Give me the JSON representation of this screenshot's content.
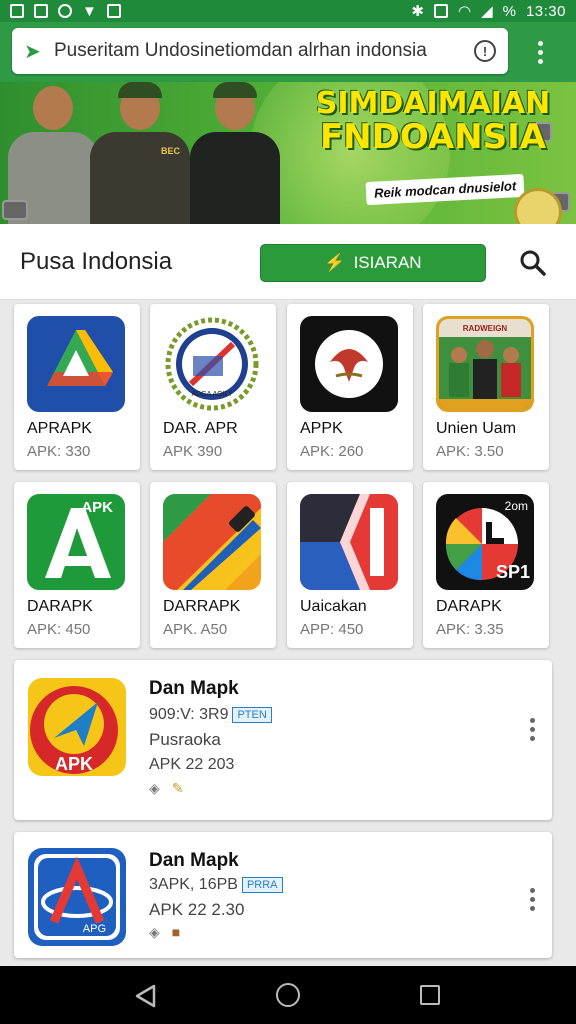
{
  "status_bar": {
    "time": "13:30",
    "battery": "%"
  },
  "browser": {
    "url": "Puseritam Undosinetiomdan alrhan indonsia",
    "info_glyph": "!"
  },
  "banner": {
    "title_line1": "SIMDAIMAIAN",
    "title_line2": "FNDOANSIA",
    "tagline": "Reik modcan dnusielot",
    "badge_text": "BEC"
  },
  "header": {
    "title": "Pusa Indonsia",
    "button_label": "ISIARAN"
  },
  "grid": [
    {
      "name": "APRAPK",
      "meta": "APK: 330",
      "icon": "drive-triangle-icon"
    },
    {
      "name": "DAR. APR",
      "meta": "APK 390",
      "icon": "emblem-pen-icon",
      "icon_text": "ADGA AGILY"
    },
    {
      "name": "APPK",
      "meta": "APK: 260",
      "icon": "garuda-icon"
    },
    {
      "name": "Unien Uam",
      "meta": "APK: 3.50",
      "icon": "team-photo-icon",
      "icon_text": "RADWEIGN"
    },
    {
      "name": "DARAPK",
      "meta": "APK: 450",
      "icon": "green-a-icon",
      "icon_text": "APK"
    },
    {
      "name": "DARRAPK",
      "meta": "APK. A50",
      "icon": "colorful-stripes-icon"
    },
    {
      "name": "Uaicakan",
      "meta": "APP: 450",
      "icon": "red-blue-k-icon"
    },
    {
      "name": "DARAPK",
      "meta": "APK: 3.35",
      "icon": "pie-sp-icon",
      "icon_text": "2om",
      "icon_text2": "SP1"
    }
  ],
  "list": [
    {
      "name": "Dan Mapk",
      "line1": "909:V: 3R9",
      "badge": "PTEN",
      "line2": "Pusraoka",
      "line3": "APK 22 203",
      "icon": "apk-arrow-icon",
      "icon_text": "APK"
    },
    {
      "name": "Dan Mapk",
      "line1": "3APK, 16PB",
      "badge": "PRRA",
      "line2": "APK 22 2.30",
      "icon": "a-logo-icon",
      "icon_text": "APG"
    }
  ],
  "colors": {
    "brand_green": "#2a9a3b",
    "status_green": "#1e8a3a"
  }
}
